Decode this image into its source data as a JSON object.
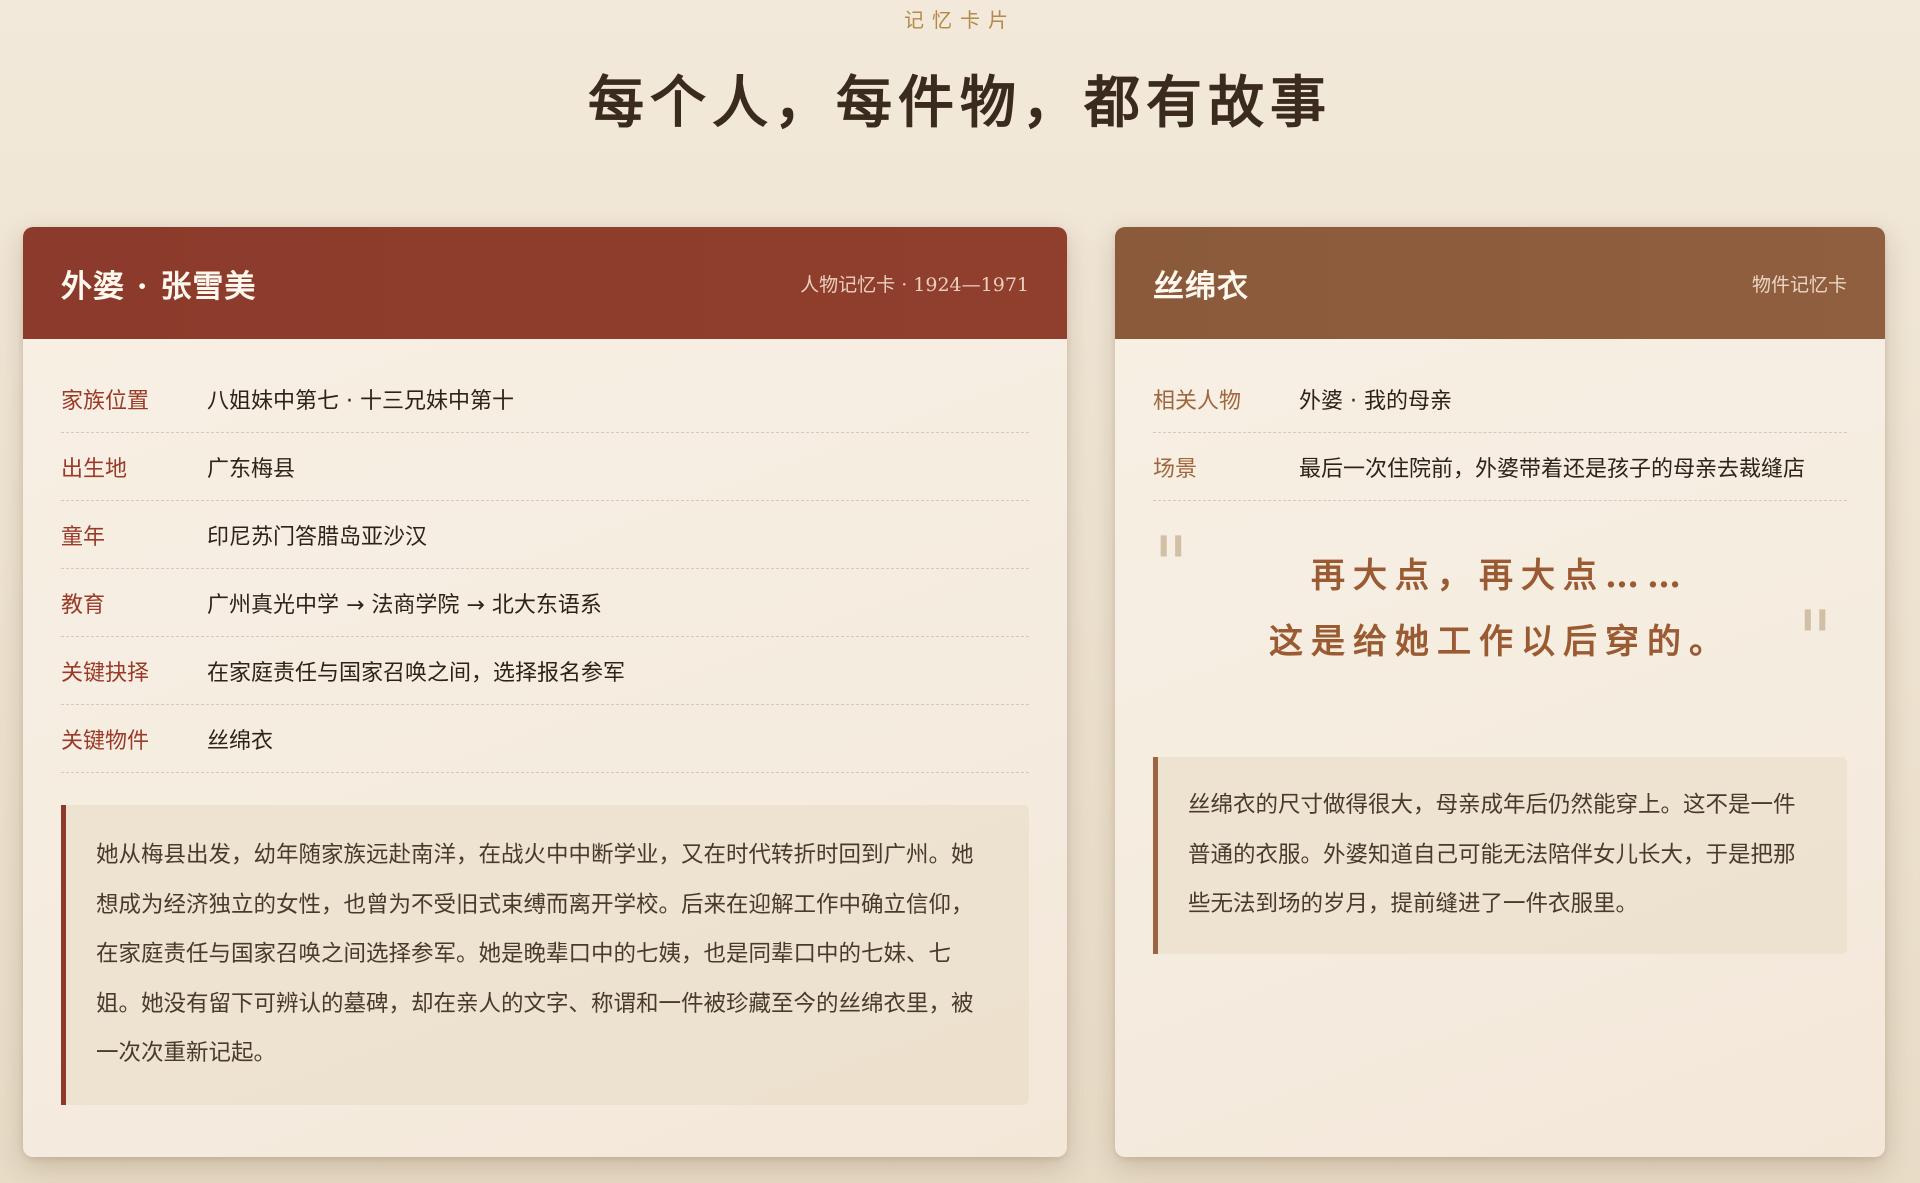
{
  "header": {
    "eyebrow": "记忆卡片",
    "title": "每个人，每件物，都有故事"
  },
  "person_card": {
    "title": "外婆 · 张雪美",
    "meta": "人物记忆卡 · 1924—1971",
    "rows": [
      {
        "label": "家族位置",
        "value": "八姐妹中第七 · 十三兄妹中第十"
      },
      {
        "label": "出生地",
        "value": "广东梅县"
      },
      {
        "label": "童年",
        "value": "印尼苏门答腊岛亚沙汉"
      },
      {
        "label": "教育",
        "value": "广州真光中学 → 法商学院 → 北大东语系"
      },
      {
        "label": "关键抉择",
        "value": "在家庭责任与国家召唤之间，选择报名参军"
      },
      {
        "label": "关键物件",
        "value": "丝绵衣"
      }
    ],
    "story": "她从梅县出发，幼年随家族远赴南洋，在战火中中断学业，又在时代转折时回到广州。她想成为经济独立的女性，也曾为不受旧式束缚而离开学校。后来在迎解工作中确立信仰，在家庭责任与国家召唤之间选择参军。她是晚辈口中的七姨，也是同辈口中的七妹、七姐。她没有留下可辨认的墓碑，却在亲人的文字、称谓和一件被珍藏至今的丝绵衣里，被一次次重新记起。"
  },
  "object_card": {
    "title": "丝绵衣",
    "meta": "物件记忆卡",
    "rows": [
      {
        "label": "相关人物",
        "value": "外婆 · 我的母亲"
      },
      {
        "label": "场景",
        "value": "最后一次住院前，外婆带着还是孩子的母亲去裁缝店"
      }
    ],
    "quote": {
      "open_mark": "\"",
      "close_mark": "\"",
      "line1": "再大点，再大点……",
      "line2": "这是给她工作以后穿的。"
    },
    "story": "丝绵衣的尺寸做得很大，母亲成年后仍然能穿上。这不是一件普通的衣服。外婆知道自己可能无法陪伴女儿长大，于是把那些无法到场的岁月，提前缝进了一件衣服里。"
  }
}
